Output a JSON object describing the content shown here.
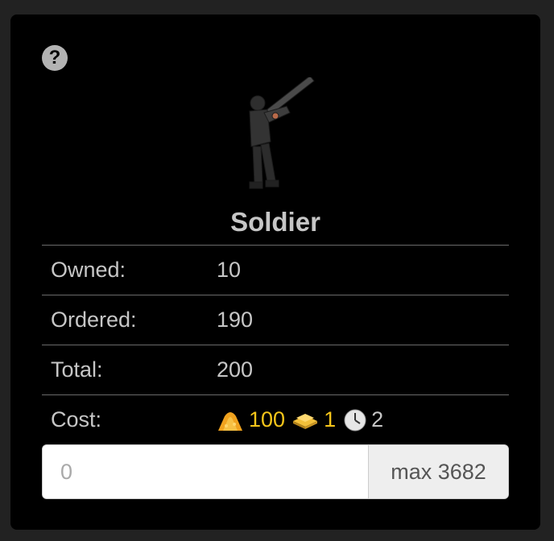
{
  "unit": {
    "name": "Soldier"
  },
  "icons": {
    "help": "question-circle-icon",
    "gold": "gold-pile-icon",
    "land": "land-stack-icon",
    "time": "clock-icon"
  },
  "rows": {
    "owned": {
      "label": "Owned:",
      "value": "10"
    },
    "ordered": {
      "label": "Ordered:",
      "value": "190"
    },
    "total": {
      "label": "Total:",
      "value": "200"
    },
    "cost": {
      "label": "Cost:",
      "gold": "100",
      "land": "1",
      "time": "2"
    }
  },
  "order": {
    "placeholder": "0",
    "max_label": "max 3682"
  },
  "colors": {
    "gold": "#f5c51a",
    "text": "#c6c6c6",
    "card_bg": "#000000",
    "page_bg": "#222222"
  }
}
